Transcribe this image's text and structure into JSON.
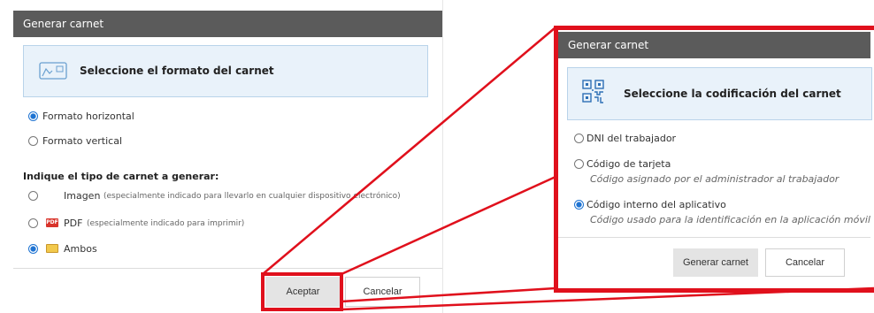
{
  "left_dialog": {
    "title": "Generar carnet",
    "info_text": "Seleccione el formato del carnet",
    "format_options": [
      {
        "label": "Formato horizontal",
        "selected": true
      },
      {
        "label": "Formato vertical",
        "selected": false
      }
    ],
    "type_heading": "Indique el tipo de carnet a generar:",
    "type_options": [
      {
        "label": "Imagen",
        "note": "(especialmente indicado para llevarlo en cualquier dispositivo electrónico)",
        "selected": false,
        "icon": ""
      },
      {
        "label": "PDF",
        "note": "(especialmente indicado para imprimir)",
        "selected": false,
        "icon": "pdf-file-icon"
      },
      {
        "label": "Ambos",
        "note": "",
        "selected": true,
        "icon": "image-file-icon"
      }
    ],
    "buttons": {
      "accept": "Aceptar",
      "cancel": "Cancelar"
    }
  },
  "right_dialog": {
    "title": "Generar carnet",
    "info_text": "Seleccione la codificación del carnet",
    "options": [
      {
        "label": "DNI del trabajador",
        "sub": "",
        "selected": false
      },
      {
        "label": "Código de tarjeta",
        "sub": "Código asignado por el administrador al trabajador",
        "selected": false
      },
      {
        "label": "Código interno del aplicativo",
        "sub": "Código usado para la identificación en la aplicación móvil",
        "selected": true
      }
    ],
    "buttons": {
      "generate": "Generar carnet",
      "cancel": "Cancelar"
    }
  },
  "colors": {
    "title_bar": "#5b5b5b",
    "info_bg": "#e9f2fa",
    "radio_accent": "#1e73d2",
    "highlight_red": "#e0101c"
  }
}
